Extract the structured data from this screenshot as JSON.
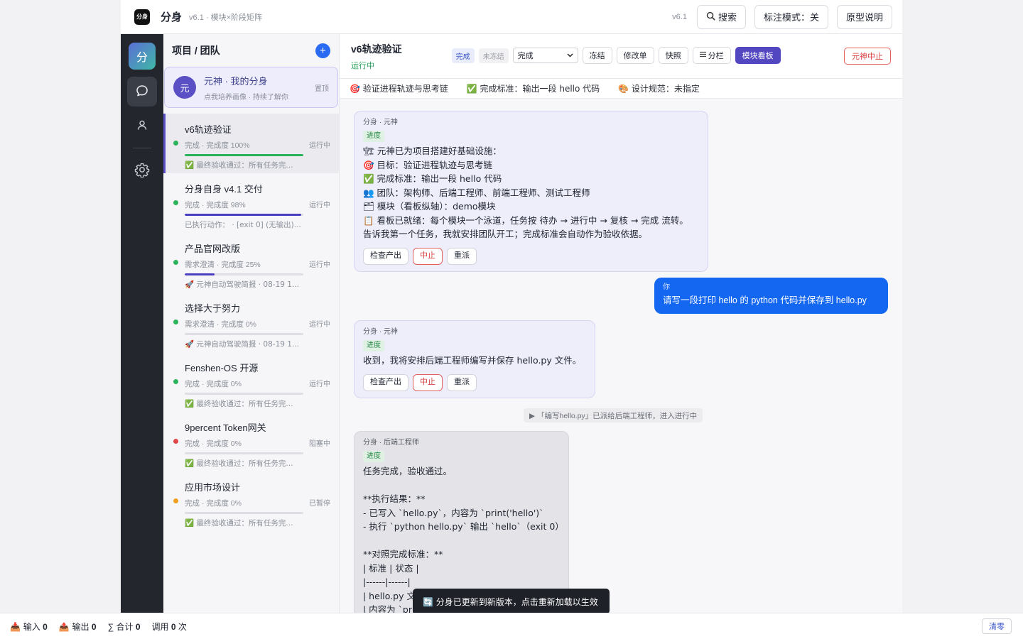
{
  "header": {
    "app_name": "分身",
    "app_subtitle": "v6.1 · 模块×阶段矩阵",
    "version": "v6.1",
    "search_label": "搜索",
    "annotate_label": "标注模式：关",
    "proto_label": "原型说明"
  },
  "rail": {
    "logo_text": "分"
  },
  "projects": {
    "title": "项目 / 团队",
    "add_label": "+",
    "yuan": {
      "avatar_text": "元",
      "name": "元神 · 我的分身",
      "sub": "点我培养画像 · 持续了解你",
      "pin": "置顶"
    },
    "items": [
      {
        "name": "v6轨迹验证",
        "meta": "完成 · 完成度 100%",
        "status": "运行中",
        "note": "✅ 最终验收通过：所有任务完...",
        "dot": "#2bb35c",
        "progress": 1.0,
        "bar": "#2bb35c"
      },
      {
        "name": "分身自身 v4.1 交付",
        "meta": "完成 · 完成度 98%",
        "status": "运行中",
        "note": "已执行动作： · [exit 0] (无输出)...",
        "dot": "#2bb35c",
        "progress": 0.98,
        "bar": "#4a3fc0"
      },
      {
        "name": "产品官网改版",
        "meta": "需求澄清 · 完成度 25%",
        "status": "运行中",
        "note": "🚀 元神自动驾驶简报 · 08-19 1...",
        "dot": "#2bb35c",
        "progress": 0.25,
        "bar": "#4a3fc0"
      },
      {
        "name": "选择大于努力",
        "meta": "需求澄清 · 完成度 0%",
        "status": "运行中",
        "note": "🚀 元神自动驾驶简报 · 08-19 1...",
        "dot": "#2bb35c",
        "progress": 0.0,
        "bar": "#4a3fc0"
      },
      {
        "name": "Fenshen-OS 开源",
        "meta": "完成 · 完成度 0%",
        "status": "运行中",
        "note": "✅ 最终验收通过：所有任务完...",
        "dot": "#2bb35c",
        "progress": 0.0,
        "bar": "#4a3fc0"
      },
      {
        "name": "9percent Token网关",
        "meta": "完成 · 完成度 0%",
        "status": "阻塞中",
        "note": "✅ 最终验收通过：所有任务完...",
        "dot": "#e04848",
        "progress": 0.0,
        "bar": "#4a3fc0"
      },
      {
        "name": "应用市场设计",
        "meta": "完成 · 完成度 0%",
        "status": "已暂停",
        "note": "✅ 最终验收通过：所有任务完...",
        "dot": "#f0a020",
        "progress": 0.0,
        "bar": "#4a3fc0"
      }
    ]
  },
  "main": {
    "title": "v6轨迹验证",
    "status": "运行中",
    "tag_done": "完成",
    "tag_unfrozen": "未冻结",
    "stage_select": "完成",
    "btn_freeze": "冻结",
    "btn_change": "修改单",
    "btn_snapshot": "快照",
    "btn_split": "分栏",
    "btn_board": "模块看板",
    "btn_stop": "元神中止",
    "goals": [
      "🎯 验证进程轨迹与思考链",
      "✅ 完成标准：输出一段 hello 代码",
      "🎨 设计规范：未指定"
    ]
  },
  "chat": {
    "msg1": {
      "from": "分身 · 元神",
      "tag": "进度",
      "lines": [
        "🏗 元神已为项目搭建好基础设施：",
        "🎯 目标：验证进程轨迹与思考链",
        "✅ 完成标准：输出一段 hello 代码",
        "👥 团队：架构师、后端工程师、前端工程师、测试工程师",
        "🗂 模块（看板纵轴）：demo模块",
        "📋 看板已就绪：每个模块一个泳道，任务按 待办 → 进行中 → 复核 → 完成 流转。",
        "告诉我第一个任务，我就安排团队开工；完成标准会自动作为验收依据。"
      ],
      "actions": [
        "检查产出",
        "中止",
        "重派"
      ]
    },
    "user": {
      "from": "你",
      "text": "请写一段打印 hello 的 python 代码并保存到 hello.py"
    },
    "msg2": {
      "from": "分身 · 元神",
      "tag": "进度",
      "lines": [
        "收到，我将安排后端工程师编写并保存 hello.py 文件。"
      ],
      "actions": [
        "检查产出",
        "中止",
        "重派"
      ]
    },
    "system": "▶ 「编写hello.py」已派给后端工程师，进入进行中",
    "msg3": {
      "from": "分身 · 后端工程师",
      "tag": "进度",
      "lines": [
        "任务完成，验收通过。",
        "",
        "**执行结果：**",
        "- 已写入 `hello.py`，内容为 `print('hello')`",
        "- 执行 `python hello.py` 输出 `hello`（exit 0）",
        "",
        "**对照完成标准：**",
        "| 标准 | 状态 |",
        "|------|------|",
        "| hello.py 文",
        "| 内容为 `pri"
      ]
    }
  },
  "toast": "🔄 分身已更新到新版本，点击重新加载以生效",
  "footer": {
    "input_label": "📥 输入",
    "input_value": "0",
    "output_label": "📤 输出",
    "output_value": "0",
    "total_label": "∑ 合计",
    "total_value": "0",
    "calls_label": "调用",
    "calls_value": "0",
    "calls_unit": "次",
    "clear_label": "清零"
  }
}
